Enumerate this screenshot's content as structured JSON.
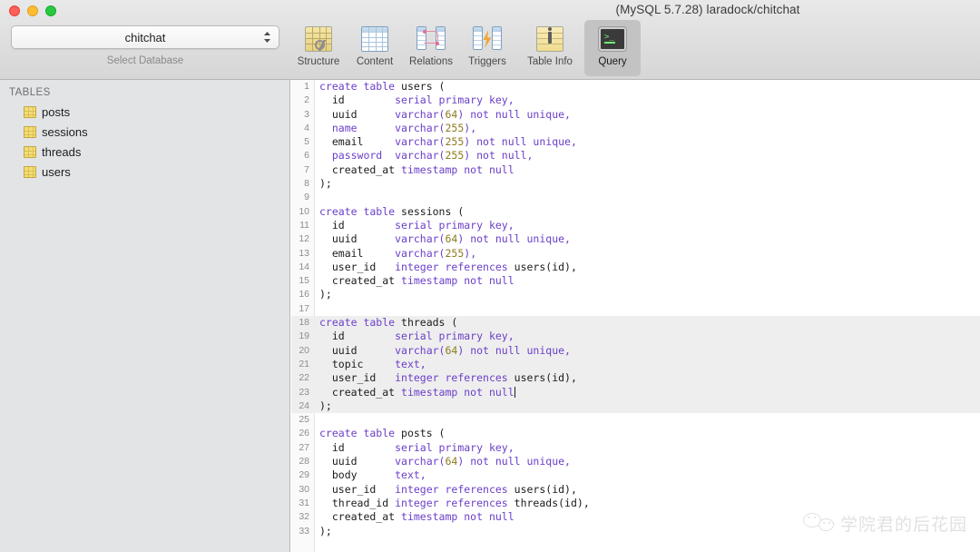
{
  "window": {
    "title": "(MySQL 5.7.28) laradock/chitchat",
    "traffic_lights": [
      "close",
      "minimize",
      "maximize"
    ]
  },
  "database_chooser": {
    "selected": "chitchat",
    "caption": "Select Database",
    "icon": "chevron-updown-icon"
  },
  "toolbar": {
    "items": [
      {
        "label": "Structure",
        "icon": "structure-icon",
        "active": false
      },
      {
        "label": "Content",
        "icon": "content-icon",
        "active": false
      },
      {
        "label": "Relations",
        "icon": "relations-icon",
        "active": false
      },
      {
        "label": "Triggers",
        "icon": "triggers-icon",
        "active": false
      },
      {
        "label": "Table Info",
        "icon": "table-info-icon",
        "active": false
      },
      {
        "label": "Query",
        "icon": "query-terminal-icon",
        "active": true
      }
    ]
  },
  "sidebar": {
    "header": "TABLES",
    "tables": [
      {
        "name": "posts",
        "icon": "table-icon"
      },
      {
        "name": "sessions",
        "icon": "table-icon"
      },
      {
        "name": "threads",
        "icon": "table-icon"
      },
      {
        "name": "users",
        "icon": "table-icon"
      }
    ]
  },
  "editor": {
    "selected_lines": [
      18,
      19,
      20,
      21,
      22,
      23,
      24
    ],
    "caret_line": 23,
    "colors": {
      "keyword": "#6b3fc8",
      "number": "#8d7b1f",
      "identifier": "#1b1b1b",
      "selection": "#eeeeee",
      "gutter_text": "#8d8d8d"
    },
    "lines": [
      {
        "n": 1,
        "tokens": [
          {
            "t": "create table ",
            "c": "k"
          },
          {
            "t": "users (",
            "c": "id"
          }
        ]
      },
      {
        "n": 2,
        "tokens": [
          {
            "t": "  id        ",
            "c": "id"
          },
          {
            "t": "serial primary key,",
            "c": "k"
          }
        ]
      },
      {
        "n": 3,
        "tokens": [
          {
            "t": "  uuid      ",
            "c": "id"
          },
          {
            "t": "varchar(",
            "c": "k"
          },
          {
            "t": "64",
            "c": "n"
          },
          {
            "t": ") not null unique,",
            "c": "k"
          }
        ]
      },
      {
        "n": 4,
        "tokens": [
          {
            "t": "  name      ",
            "c": "k"
          },
          {
            "t": "varchar(",
            "c": "k"
          },
          {
            "t": "255",
            "c": "n"
          },
          {
            "t": "),",
            "c": "k"
          }
        ]
      },
      {
        "n": 5,
        "tokens": [
          {
            "t": "  email     ",
            "c": "id"
          },
          {
            "t": "varchar(",
            "c": "k"
          },
          {
            "t": "255",
            "c": "n"
          },
          {
            "t": ") not null unique,",
            "c": "k"
          }
        ]
      },
      {
        "n": 6,
        "tokens": [
          {
            "t": "  password  ",
            "c": "k"
          },
          {
            "t": "varchar(",
            "c": "k"
          },
          {
            "t": "255",
            "c": "n"
          },
          {
            "t": ") not null,",
            "c": "k"
          }
        ]
      },
      {
        "n": 7,
        "tokens": [
          {
            "t": "  created_at ",
            "c": "id"
          },
          {
            "t": "timestamp not null",
            "c": "k"
          }
        ]
      },
      {
        "n": 8,
        "tokens": [
          {
            "t": ");",
            "c": "id"
          }
        ]
      },
      {
        "n": 9,
        "tokens": [
          {
            "t": "",
            "c": "id"
          }
        ]
      },
      {
        "n": 10,
        "tokens": [
          {
            "t": "create table ",
            "c": "k"
          },
          {
            "t": "sessions (",
            "c": "id"
          }
        ]
      },
      {
        "n": 11,
        "tokens": [
          {
            "t": "  id        ",
            "c": "id"
          },
          {
            "t": "serial primary key,",
            "c": "k"
          }
        ]
      },
      {
        "n": 12,
        "tokens": [
          {
            "t": "  uuid      ",
            "c": "id"
          },
          {
            "t": "varchar(",
            "c": "k"
          },
          {
            "t": "64",
            "c": "n"
          },
          {
            "t": ") not null unique,",
            "c": "k"
          }
        ]
      },
      {
        "n": 13,
        "tokens": [
          {
            "t": "  email     ",
            "c": "id"
          },
          {
            "t": "varchar(",
            "c": "k"
          },
          {
            "t": "255",
            "c": "n"
          },
          {
            "t": "),",
            "c": "k"
          }
        ]
      },
      {
        "n": 14,
        "tokens": [
          {
            "t": "  user_id   ",
            "c": "id"
          },
          {
            "t": "integer references ",
            "c": "k"
          },
          {
            "t": "users(id),",
            "c": "id"
          }
        ]
      },
      {
        "n": 15,
        "tokens": [
          {
            "t": "  created_at ",
            "c": "id"
          },
          {
            "t": "timestamp not null",
            "c": "k"
          }
        ]
      },
      {
        "n": 16,
        "tokens": [
          {
            "t": ");",
            "c": "id"
          }
        ]
      },
      {
        "n": 17,
        "tokens": [
          {
            "t": "",
            "c": "id"
          }
        ]
      },
      {
        "n": 18,
        "tokens": [
          {
            "t": "create table ",
            "c": "k"
          },
          {
            "t": "threads (",
            "c": "id"
          }
        ]
      },
      {
        "n": 19,
        "tokens": [
          {
            "t": "  id        ",
            "c": "id"
          },
          {
            "t": "serial primary key,",
            "c": "k"
          }
        ]
      },
      {
        "n": 20,
        "tokens": [
          {
            "t": "  uuid      ",
            "c": "id"
          },
          {
            "t": "varchar(",
            "c": "k"
          },
          {
            "t": "64",
            "c": "n"
          },
          {
            "t": ") not null unique,",
            "c": "k"
          }
        ]
      },
      {
        "n": 21,
        "tokens": [
          {
            "t": "  topic     ",
            "c": "id"
          },
          {
            "t": "text,",
            "c": "k"
          }
        ]
      },
      {
        "n": 22,
        "tokens": [
          {
            "t": "  user_id   ",
            "c": "id"
          },
          {
            "t": "integer references ",
            "c": "k"
          },
          {
            "t": "users(id),",
            "c": "id"
          }
        ]
      },
      {
        "n": 23,
        "tokens": [
          {
            "t": "  created_at ",
            "c": "id"
          },
          {
            "t": "timestamp not null",
            "c": "k"
          }
        ],
        "caret": true
      },
      {
        "n": 24,
        "tokens": [
          {
            "t": ");",
            "c": "id"
          }
        ]
      },
      {
        "n": 25,
        "tokens": [
          {
            "t": "",
            "c": "id"
          }
        ]
      },
      {
        "n": 26,
        "tokens": [
          {
            "t": "create table ",
            "c": "k"
          },
          {
            "t": "posts (",
            "c": "id"
          }
        ]
      },
      {
        "n": 27,
        "tokens": [
          {
            "t": "  id        ",
            "c": "id"
          },
          {
            "t": "serial primary key,",
            "c": "k"
          }
        ]
      },
      {
        "n": 28,
        "tokens": [
          {
            "t": "  uuid      ",
            "c": "id"
          },
          {
            "t": "varchar(",
            "c": "k"
          },
          {
            "t": "64",
            "c": "n"
          },
          {
            "t": ") not null unique,",
            "c": "k"
          }
        ]
      },
      {
        "n": 29,
        "tokens": [
          {
            "t": "  body      ",
            "c": "id"
          },
          {
            "t": "text,",
            "c": "k"
          }
        ]
      },
      {
        "n": 30,
        "tokens": [
          {
            "t": "  user_id   ",
            "c": "id"
          },
          {
            "t": "integer references ",
            "c": "k"
          },
          {
            "t": "users(id),",
            "c": "id"
          }
        ]
      },
      {
        "n": 31,
        "tokens": [
          {
            "t": "  thread_id ",
            "c": "id"
          },
          {
            "t": "integer references ",
            "c": "k"
          },
          {
            "t": "threads(id),",
            "c": "id"
          }
        ]
      },
      {
        "n": 32,
        "tokens": [
          {
            "t": "  created_at ",
            "c": "id"
          },
          {
            "t": "timestamp not null",
            "c": "k"
          }
        ]
      },
      {
        "n": 33,
        "tokens": [
          {
            "t": ");",
            "c": "id"
          }
        ]
      }
    ]
  },
  "watermark": {
    "logo": "wechat-logo-icon",
    "text": "学院君的后花园"
  }
}
